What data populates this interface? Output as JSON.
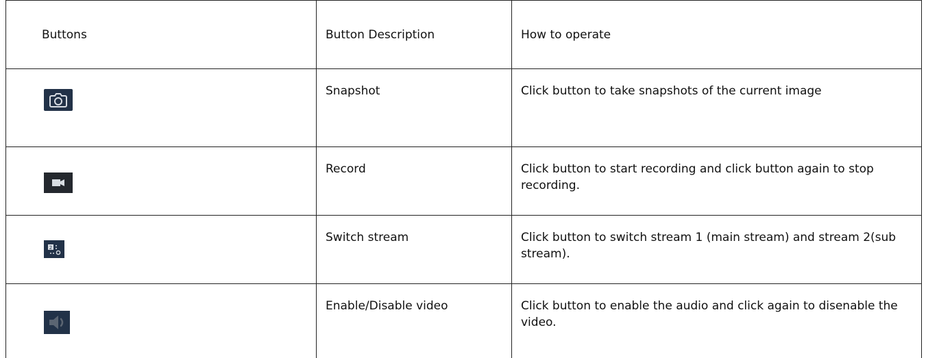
{
  "table": {
    "headers": {
      "buttons": "Buttons",
      "description": "Button Description",
      "operate": "How to operate"
    },
    "rows": [
      {
        "icon": "camera-icon",
        "description": "Snapshot",
        "operate": "Click button to take snapshots of the current image"
      },
      {
        "icon": "video-camera-icon",
        "description": "Record",
        "operate": "Click button to start recording and click button again to stop recording."
      },
      {
        "icon": "switch-stream-icon",
        "description": "Switch stream",
        "operate": "Click button to switch stream 1 (main stream) and stream 2(sub stream)."
      },
      {
        "icon": "speaker-icon",
        "description": "Enable/Disable video",
        "operate": "Click button to enable the audio and click again to disenable the video."
      }
    ]
  },
  "colors": {
    "icon_bg_dark_blue": "#223248",
    "icon_bg_dark": "#24282e",
    "icon_fg_light": "#d8dde3",
    "speaker_fg": "#5b6572",
    "border": "#222222"
  }
}
